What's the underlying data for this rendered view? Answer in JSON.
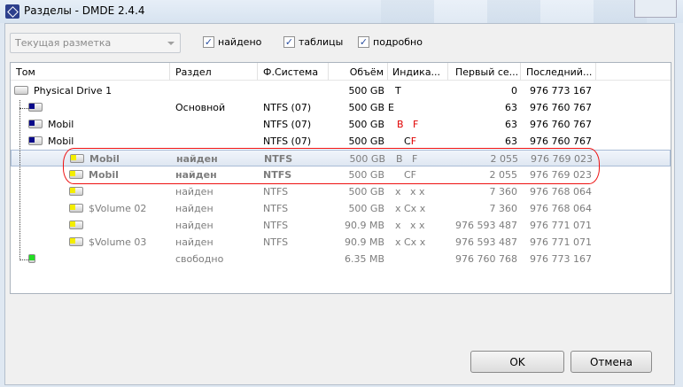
{
  "window": {
    "title": "Разделы - DMDE 2.4.4"
  },
  "toolbar": {
    "combo_value": "Текущая разметка",
    "checkboxes": [
      {
        "label": "найдено",
        "checked": true
      },
      {
        "label": "таблицы",
        "checked": true
      },
      {
        "label": "подробно",
        "checked": true
      }
    ]
  },
  "columns": [
    "Том",
    "Раздел",
    "Ф.Система",
    "Объём",
    "Индика...",
    "Первый се...",
    "Последний..."
  ],
  "rows": [
    {
      "name": "Physical Drive 1",
      "part": "",
      "fs": "",
      "size": "500 GB",
      "ind": "T",
      "first": "0",
      "last": "976 773 167",
      "style": "normal",
      "icon": "drive"
    },
    {
      "name": "",
      "part": "Основной",
      "fs": "NTFS (07)",
      "size": "500 GB",
      "ind": "E",
      "first": "63",
      "last": "976 760 767",
      "style": "normal",
      "icon": "blue"
    },
    {
      "name": "Mobil",
      "part": "",
      "fs": "NTFS (07)",
      "size": "500 GB",
      "ind": "B   F",
      "first": "63",
      "last": "976 760 767",
      "style": "normal",
      "icon": "blue",
      "ind_color": "red"
    },
    {
      "name": "Mobil",
      "part": "",
      "fs": "NTFS (07)",
      "size": "500 GB",
      "ind": "C",
      "ind2": "F",
      "first": "63",
      "last": "976 760 767",
      "style": "normal",
      "icon": "blue"
    },
    {
      "name": "Mobil",
      "part": "найден",
      "fs": "NTFS",
      "size": "500 GB",
      "ind": "B   F",
      "first": "2 055",
      "last": "976 769 023",
      "style": "found-bold",
      "icon": "yellow",
      "selected": true
    },
    {
      "name": "Mobil",
      "part": "найден",
      "fs": "NTFS",
      "size": "500 GB",
      "ind": "CF",
      "first": "2 055",
      "last": "976 769 023",
      "style": "found-bold",
      "icon": "yellow"
    },
    {
      "name": "",
      "part": "найден",
      "fs": "NTFS",
      "size": "500 GB",
      "ind": "x   x x",
      "first": "7 360",
      "last": "976 768 064",
      "style": "found",
      "icon": "yellow"
    },
    {
      "name": "$Volume 02",
      "part": "найден",
      "fs": "NTFS",
      "size": "500 GB",
      "ind": "x Cx x",
      "first": "7 360",
      "last": "976 768 064",
      "style": "found",
      "icon": "yellow"
    },
    {
      "name": "",
      "part": "найден",
      "fs": "NTFS",
      "size": "90.9 MB",
      "ind": "x   x x",
      "first": "976 593 487",
      "last": "976 771 071",
      "style": "found",
      "icon": "yellow"
    },
    {
      "name": "$Volume 03",
      "part": "найден",
      "fs": "NTFS",
      "size": "90.9 MB",
      "ind": "x Cx x",
      "first": "976 593 487",
      "last": "976 771 071",
      "style": "found",
      "icon": "yellow"
    },
    {
      "name": "",
      "part": "свободно",
      "fs": "",
      "size": "6.35 MB",
      "ind": "",
      "first": "976 760 768",
      "last": "976 773 167",
      "style": "found",
      "icon": "free"
    }
  ],
  "buttons": {
    "ok": "OK",
    "cancel": "Отмена"
  }
}
